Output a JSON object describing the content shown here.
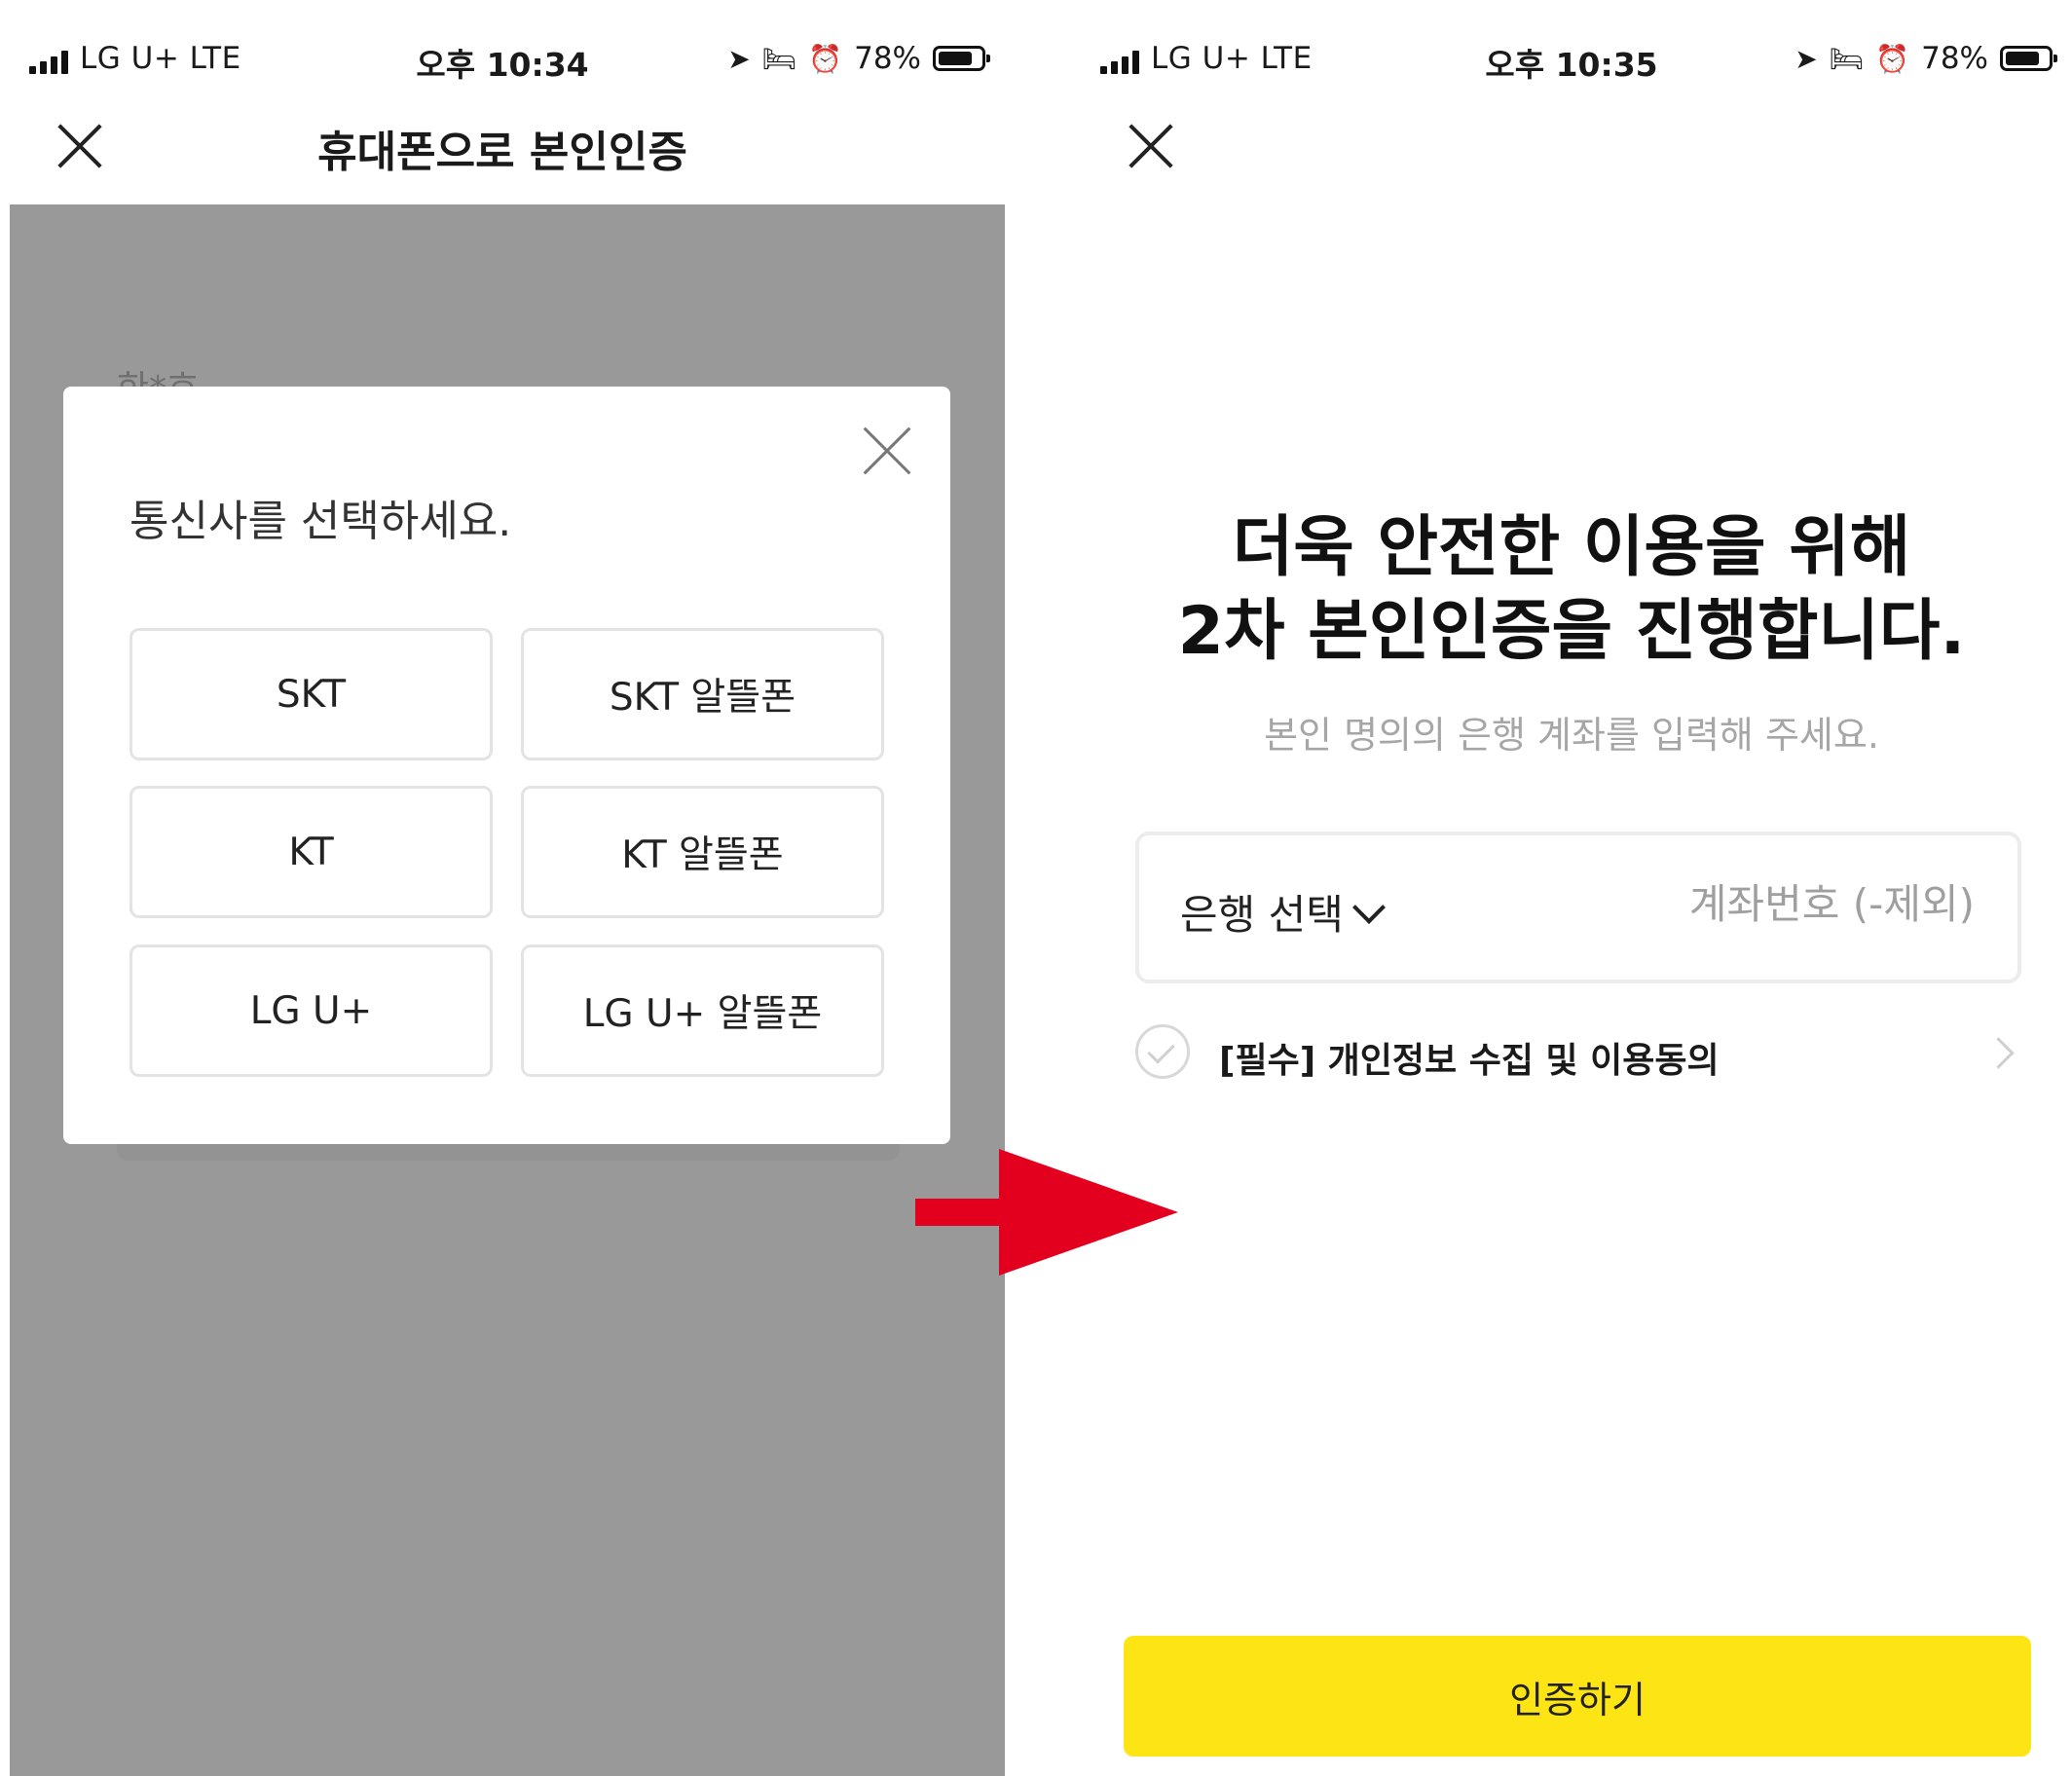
{
  "left_screen": {
    "status_bar": {
      "carrier": "LG U+   LTE",
      "time": "오후 10:34",
      "battery": "78%"
    },
    "title": "휴대폰으로 본인인증",
    "background_name": "한*호",
    "modal": {
      "title": "통신사를 선택하세요.",
      "options": [
        "SKT",
        "SKT 알뜰폰",
        "KT",
        "KT 알뜰폰",
        "LG U+",
        "LG U+ 알뜰폰"
      ]
    }
  },
  "right_screen": {
    "status_bar": {
      "carrier": "LG U+   LTE",
      "time": "오후 10:35",
      "battery": "78%"
    },
    "headline_line1": "더욱 안전한 이용을 위해",
    "headline_line2": "2차 본인인증을 진행합니다.",
    "subtitle": "본인 명의의 은행 계좌를 입력해 주세요.",
    "bank_select_label": "은행 선택",
    "account_placeholder": "계좌번호 (-제외)",
    "agreement_label": "[필수] 개인정보 수집 및 이용동의",
    "cta_label": "인증하기"
  },
  "colors": {
    "dim_overlay": "#999999",
    "cta_yellow": "#fde414",
    "arrow_red": "#e3001f"
  },
  "icons": [
    "signal-icon",
    "location-arrow-icon",
    "bed-icon",
    "alarm-icon",
    "battery-icon",
    "close-icon",
    "chevron-down-icon",
    "check-circle-icon",
    "chevron-right-icon",
    "red-arrow-icon"
  ]
}
